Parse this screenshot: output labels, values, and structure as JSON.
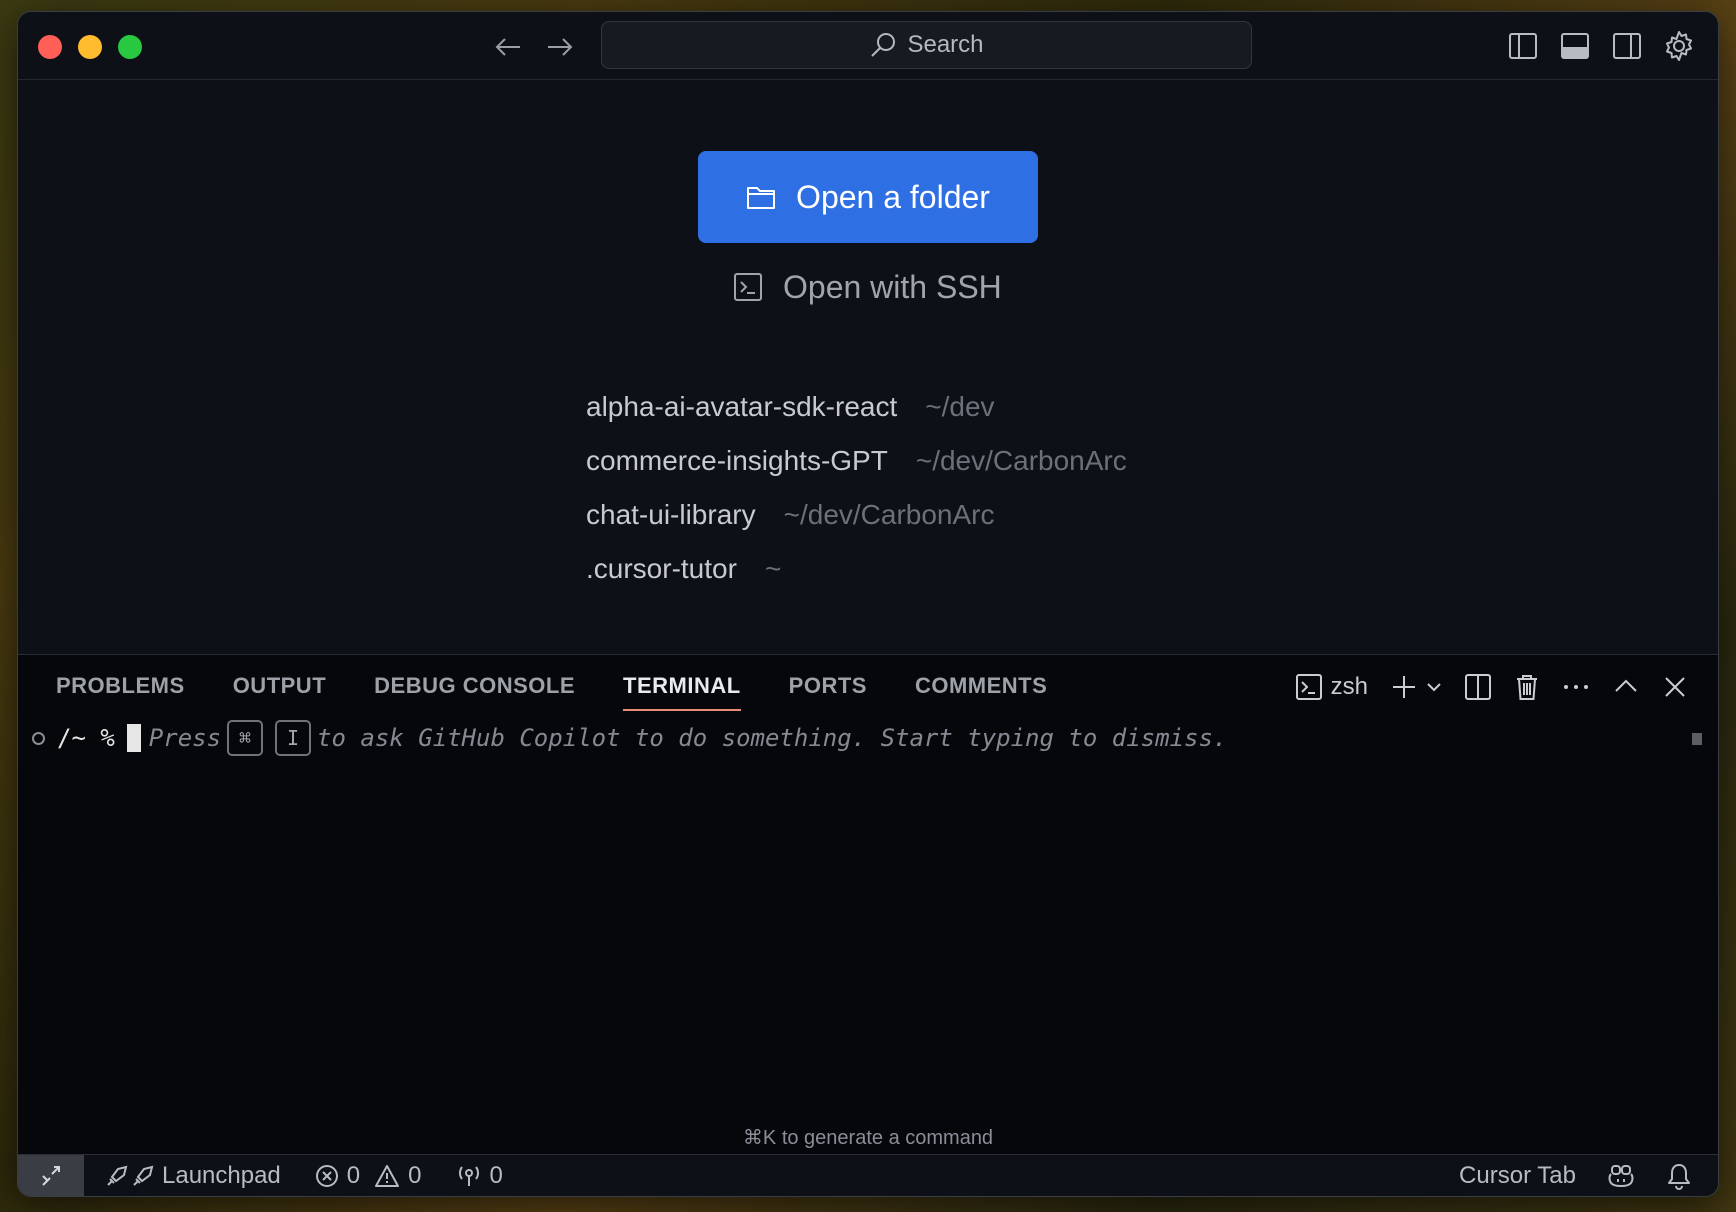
{
  "titlebar": {
    "search_placeholder": "Search"
  },
  "welcome": {
    "open_folder_label": "Open a folder",
    "open_ssh_label": "Open with SSH",
    "recent": [
      {
        "name": "alpha-ai-avatar-sdk-react",
        "path": "~/dev"
      },
      {
        "name": "commerce-insights-GPT",
        "path": "~/dev/CarbonArc"
      },
      {
        "name": "chat-ui-library",
        "path": "~/dev/CarbonArc"
      },
      {
        "name": ".cursor-tutor",
        "path": "~"
      }
    ]
  },
  "panel": {
    "tabs": [
      "PROBLEMS",
      "OUTPUT",
      "DEBUG CONSOLE",
      "TERMINAL",
      "PORTS",
      "COMMENTS"
    ],
    "active_tab": "TERMINAL",
    "shell_name": "zsh"
  },
  "terminal": {
    "prompt": "/~ %",
    "hint_press": "Press",
    "key1": "⌘",
    "key2": "I",
    "hint_rest": "to ask GitHub Copilot to do something. Start typing to dismiss.",
    "generate_hint": "⌘K to generate a command"
  },
  "statusbar": {
    "launchpad_label": "Launchpad",
    "errors": "0",
    "warnings": "0",
    "ports": "0",
    "cursor_tab_label": "Cursor Tab"
  },
  "colors": {
    "accent": "#2f6fe4",
    "active_tab_underline": "#e58b7a"
  }
}
